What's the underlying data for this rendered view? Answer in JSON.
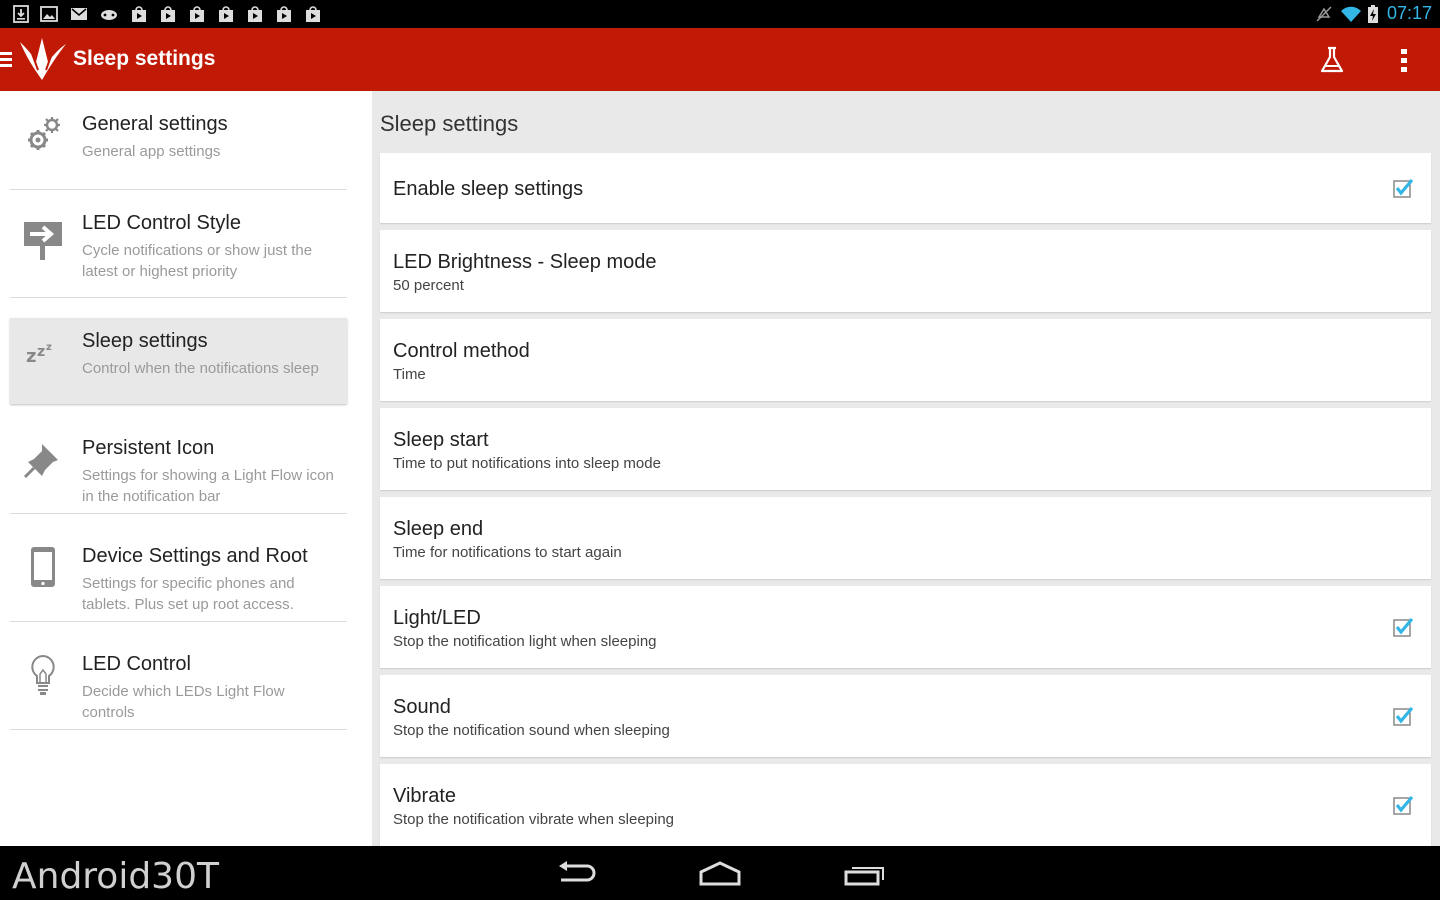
{
  "status_bar": {
    "time": "07:17",
    "left_icons": [
      "download-icon",
      "image-icon",
      "gmail-icon",
      "gamepad-icon",
      "play-store-icon",
      "play-store-icon",
      "play-store-icon",
      "play-store-icon",
      "play-store-icon",
      "play-store-icon",
      "play-store-icon"
    ],
    "right_icons": [
      "mute-icon",
      "wifi-icon",
      "battery-charging-icon"
    ],
    "time_color": "#33b5e5"
  },
  "action_bar": {
    "title": "Sleep settings",
    "background": "#c01a06",
    "actions": [
      "flask-icon",
      "overflow-menu-icon"
    ]
  },
  "left_nav": {
    "items": [
      {
        "title": "General settings",
        "subtitle": "General app settings",
        "icon": "gear-icon"
      },
      {
        "title": "LED Control Style",
        "subtitle": "Cycle notifications or show just the latest or highest priority",
        "icon": "arrow-sign-icon"
      },
      {
        "title": "Sleep settings",
        "subtitle": "Control when the notifications sleep",
        "icon": "zzz-icon",
        "selected": true
      },
      {
        "title": "Persistent Icon",
        "subtitle": "Settings for showing a Light Flow icon in the notification bar",
        "icon": "pin-icon"
      },
      {
        "title": "Device Settings and Root",
        "subtitle": "Settings for specific phones and tablets. Plus set up root access.",
        "icon": "phone-icon"
      },
      {
        "title": "LED Control",
        "subtitle": "Decide which LEDs Light Flow controls",
        "icon": "lightbulb-icon"
      }
    ]
  },
  "content": {
    "title": "Sleep settings",
    "settings": [
      {
        "title": "Enable sleep settings",
        "subtitle": "",
        "checked": true
      },
      {
        "title": "LED Brightness - Sleep mode",
        "subtitle": "50 percent"
      },
      {
        "title": "Control method",
        "subtitle": "Time"
      },
      {
        "title": "Sleep start",
        "subtitle": "Time to put notifications into sleep mode"
      },
      {
        "title": "Sleep end",
        "subtitle": "Time for notifications to start again"
      },
      {
        "title": "Light/LED",
        "subtitle": "Stop the notification light when sleeping",
        "checked": true
      },
      {
        "title": "Sound",
        "subtitle": "Stop the notification sound when sleeping",
        "checked": true
      },
      {
        "title": "Vibrate",
        "subtitle": "Stop the notification vibrate when sleeping",
        "checked": true
      }
    ],
    "checkbox_color": "#33b5e5"
  },
  "nav_bar": {
    "watermark": "Android30T",
    "buttons": [
      "back-icon",
      "home-icon",
      "recents-icon"
    ]
  }
}
